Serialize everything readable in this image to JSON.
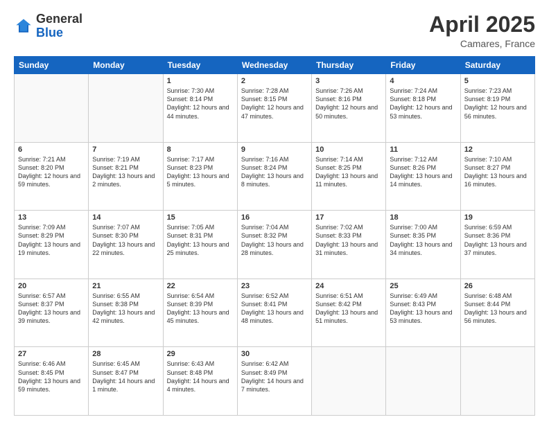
{
  "logo": {
    "general": "General",
    "blue": "Blue"
  },
  "header": {
    "month": "April 2025",
    "location": "Camares, France"
  },
  "weekdays": [
    "Sunday",
    "Monday",
    "Tuesday",
    "Wednesday",
    "Thursday",
    "Friday",
    "Saturday"
  ],
  "weeks": [
    [
      {
        "day": "",
        "sunrise": "",
        "sunset": "",
        "daylight": ""
      },
      {
        "day": "",
        "sunrise": "",
        "sunset": "",
        "daylight": ""
      },
      {
        "day": "1",
        "sunrise": "Sunrise: 7:30 AM",
        "sunset": "Sunset: 8:14 PM",
        "daylight": "Daylight: 12 hours and 44 minutes."
      },
      {
        "day": "2",
        "sunrise": "Sunrise: 7:28 AM",
        "sunset": "Sunset: 8:15 PM",
        "daylight": "Daylight: 12 hours and 47 minutes."
      },
      {
        "day": "3",
        "sunrise": "Sunrise: 7:26 AM",
        "sunset": "Sunset: 8:16 PM",
        "daylight": "Daylight: 12 hours and 50 minutes."
      },
      {
        "day": "4",
        "sunrise": "Sunrise: 7:24 AM",
        "sunset": "Sunset: 8:18 PM",
        "daylight": "Daylight: 12 hours and 53 minutes."
      },
      {
        "day": "5",
        "sunrise": "Sunrise: 7:23 AM",
        "sunset": "Sunset: 8:19 PM",
        "daylight": "Daylight: 12 hours and 56 minutes."
      }
    ],
    [
      {
        "day": "6",
        "sunrise": "Sunrise: 7:21 AM",
        "sunset": "Sunset: 8:20 PM",
        "daylight": "Daylight: 12 hours and 59 minutes."
      },
      {
        "day": "7",
        "sunrise": "Sunrise: 7:19 AM",
        "sunset": "Sunset: 8:21 PM",
        "daylight": "Daylight: 13 hours and 2 minutes."
      },
      {
        "day": "8",
        "sunrise": "Sunrise: 7:17 AM",
        "sunset": "Sunset: 8:23 PM",
        "daylight": "Daylight: 13 hours and 5 minutes."
      },
      {
        "day": "9",
        "sunrise": "Sunrise: 7:16 AM",
        "sunset": "Sunset: 8:24 PM",
        "daylight": "Daylight: 13 hours and 8 minutes."
      },
      {
        "day": "10",
        "sunrise": "Sunrise: 7:14 AM",
        "sunset": "Sunset: 8:25 PM",
        "daylight": "Daylight: 13 hours and 11 minutes."
      },
      {
        "day": "11",
        "sunrise": "Sunrise: 7:12 AM",
        "sunset": "Sunset: 8:26 PM",
        "daylight": "Daylight: 13 hours and 14 minutes."
      },
      {
        "day": "12",
        "sunrise": "Sunrise: 7:10 AM",
        "sunset": "Sunset: 8:27 PM",
        "daylight": "Daylight: 13 hours and 16 minutes."
      }
    ],
    [
      {
        "day": "13",
        "sunrise": "Sunrise: 7:09 AM",
        "sunset": "Sunset: 8:29 PM",
        "daylight": "Daylight: 13 hours and 19 minutes."
      },
      {
        "day": "14",
        "sunrise": "Sunrise: 7:07 AM",
        "sunset": "Sunset: 8:30 PM",
        "daylight": "Daylight: 13 hours and 22 minutes."
      },
      {
        "day": "15",
        "sunrise": "Sunrise: 7:05 AM",
        "sunset": "Sunset: 8:31 PM",
        "daylight": "Daylight: 13 hours and 25 minutes."
      },
      {
        "day": "16",
        "sunrise": "Sunrise: 7:04 AM",
        "sunset": "Sunset: 8:32 PM",
        "daylight": "Daylight: 13 hours and 28 minutes."
      },
      {
        "day": "17",
        "sunrise": "Sunrise: 7:02 AM",
        "sunset": "Sunset: 8:33 PM",
        "daylight": "Daylight: 13 hours and 31 minutes."
      },
      {
        "day": "18",
        "sunrise": "Sunrise: 7:00 AM",
        "sunset": "Sunset: 8:35 PM",
        "daylight": "Daylight: 13 hours and 34 minutes."
      },
      {
        "day": "19",
        "sunrise": "Sunrise: 6:59 AM",
        "sunset": "Sunset: 8:36 PM",
        "daylight": "Daylight: 13 hours and 37 minutes."
      }
    ],
    [
      {
        "day": "20",
        "sunrise": "Sunrise: 6:57 AM",
        "sunset": "Sunset: 8:37 PM",
        "daylight": "Daylight: 13 hours and 39 minutes."
      },
      {
        "day": "21",
        "sunrise": "Sunrise: 6:55 AM",
        "sunset": "Sunset: 8:38 PM",
        "daylight": "Daylight: 13 hours and 42 minutes."
      },
      {
        "day": "22",
        "sunrise": "Sunrise: 6:54 AM",
        "sunset": "Sunset: 8:39 PM",
        "daylight": "Daylight: 13 hours and 45 minutes."
      },
      {
        "day": "23",
        "sunrise": "Sunrise: 6:52 AM",
        "sunset": "Sunset: 8:41 PM",
        "daylight": "Daylight: 13 hours and 48 minutes."
      },
      {
        "day": "24",
        "sunrise": "Sunrise: 6:51 AM",
        "sunset": "Sunset: 8:42 PM",
        "daylight": "Daylight: 13 hours and 51 minutes."
      },
      {
        "day": "25",
        "sunrise": "Sunrise: 6:49 AM",
        "sunset": "Sunset: 8:43 PM",
        "daylight": "Daylight: 13 hours and 53 minutes."
      },
      {
        "day": "26",
        "sunrise": "Sunrise: 6:48 AM",
        "sunset": "Sunset: 8:44 PM",
        "daylight": "Daylight: 13 hours and 56 minutes."
      }
    ],
    [
      {
        "day": "27",
        "sunrise": "Sunrise: 6:46 AM",
        "sunset": "Sunset: 8:45 PM",
        "daylight": "Daylight: 13 hours and 59 minutes."
      },
      {
        "day": "28",
        "sunrise": "Sunrise: 6:45 AM",
        "sunset": "Sunset: 8:47 PM",
        "daylight": "Daylight: 14 hours and 1 minute."
      },
      {
        "day": "29",
        "sunrise": "Sunrise: 6:43 AM",
        "sunset": "Sunset: 8:48 PM",
        "daylight": "Daylight: 14 hours and 4 minutes."
      },
      {
        "day": "30",
        "sunrise": "Sunrise: 6:42 AM",
        "sunset": "Sunset: 8:49 PM",
        "daylight": "Daylight: 14 hours and 7 minutes."
      },
      {
        "day": "",
        "sunrise": "",
        "sunset": "",
        "daylight": ""
      },
      {
        "day": "",
        "sunrise": "",
        "sunset": "",
        "daylight": ""
      },
      {
        "day": "",
        "sunrise": "",
        "sunset": "",
        "daylight": ""
      }
    ]
  ]
}
